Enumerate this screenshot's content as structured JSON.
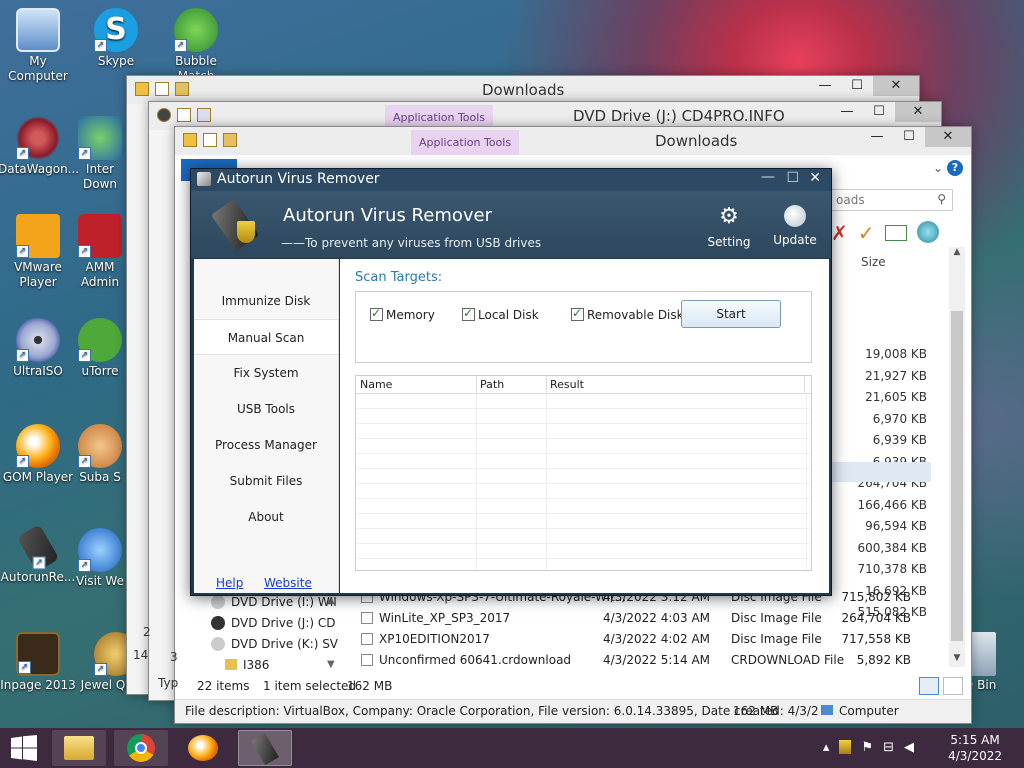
{
  "desktop_icons": [
    {
      "label": "My Computer",
      "icon": "my-computer-icon"
    },
    {
      "label": "Skype",
      "icon": "skype-icon"
    },
    {
      "label": "Bubble Match",
      "icon": "bubble-match-icon"
    },
    {
      "label": "DataWagon...",
      "icon": "datawagon-icon"
    },
    {
      "label": "Inter Down",
      "icon": "internet-download-icon"
    },
    {
      "label": "VMware Player",
      "icon": "vmware-icon"
    },
    {
      "label": "AMM Admin",
      "icon": "amm-icon"
    },
    {
      "label": "UltraISO",
      "icon": "ultraiso-icon"
    },
    {
      "label": "uTorre",
      "icon": "utorrent-icon"
    },
    {
      "label": "GOM Player",
      "icon": "gom-player-icon"
    },
    {
      "label": "Suba S",
      "icon": "subtitle-icon"
    },
    {
      "label": "AutorunRe...",
      "icon": "autorun-remover-icon"
    },
    {
      "label": "Visit We",
      "icon": "visit-web-icon"
    },
    {
      "label": "Inpage 2013",
      "icon": "inpage-icon"
    },
    {
      "label": "Jewel Quest",
      "icon": "jewel-quest-icon"
    },
    {
      "label": "cle Bin",
      "icon": "recycle-bin-icon"
    }
  ],
  "explorer_back": {
    "title": "Downloads"
  },
  "explorer_dvd": {
    "title": "DVD Drive (J:) CD4PRO.INFO",
    "app_tools": "Application Tools"
  },
  "explorer_front": {
    "title": "Downloads",
    "app_tools": "Application Tools",
    "search_placeholder": "oads",
    "column_size": "Size",
    "sizes": [
      "19,008 KB",
      "21,927 KB",
      "21,605 KB",
      "6,970 KB",
      "6,939 KB",
      "6,939 KB",
      "264,704 KB",
      "166,466 KB",
      "96,594 KB",
      "600,384 KB",
      "710,378 KB",
      "16,692 KB",
      "515,082 KB"
    ],
    "files": [
      {
        "name": "Windows-Xp-SP3-7-Ultimate-Royale-Wit...",
        "date": "4/3/2022 3:12 AM",
        "type": "Disc Image File",
        "size": "715,802 KB"
      },
      {
        "name": "WinLite_XP_SP3_2017",
        "date": "4/3/2022 4:03 AM",
        "type": "Disc Image File",
        "size": "264,704 KB"
      },
      {
        "name": "XP10EDITION2017",
        "date": "4/3/2022 4:02 AM",
        "type": "Disc Image File",
        "size": "717,558 KB"
      },
      {
        "name": "Unconfirmed 60641.crdownload",
        "date": "4/3/2022 5:14 AM",
        "type": "CRDOWNLOAD File",
        "size": "5,892 KB"
      }
    ],
    "nav": [
      "DVD Drive (I:) WII",
      "DVD Drive (J:) CD",
      "DVD Drive (K:) SV",
      "I386"
    ],
    "status_items": "22 items",
    "status_selected": "1 item selected",
    "status_size": "162 MB",
    "desc": "File description: VirtualBox, Company: Oracle Corporation, File version: 6.0.14.33895, Date created: 4/3/2",
    "desc_size": "162 MB",
    "desc_location": "Computer",
    "left_edge": [
      "14",
      "3",
      "2",
      "Typ"
    ]
  },
  "avr": {
    "window_title": "Autorun Virus Remover",
    "header_title": "Autorun Virus Remover",
    "header_subtitle": "——To prevent any viruses from USB drives",
    "setting": "Setting",
    "update": "Update",
    "menu": [
      "Immunize Disk",
      "Manual Scan",
      "Fix System",
      "USB Tools",
      "Process Manager",
      "Submit Files",
      "About"
    ],
    "selected_menu": "Manual Scan",
    "help": "Help",
    "website": "Website",
    "scan_targets_label": "Scan Targets:",
    "targets": [
      {
        "label": "Memory",
        "checked": true
      },
      {
        "label": "Local Disk",
        "checked": true
      },
      {
        "label": "Removable Disk",
        "checked": true
      }
    ],
    "start": "Start",
    "columns": [
      "Name",
      "Path",
      "Result"
    ]
  },
  "taskbar": {
    "time": "5:15 AM",
    "date": "4/3/2022",
    "apps": [
      "start-button",
      "file-explorer-icon",
      "chrome-icon",
      "gom-player-icon",
      "autorun-remover-icon"
    ]
  }
}
